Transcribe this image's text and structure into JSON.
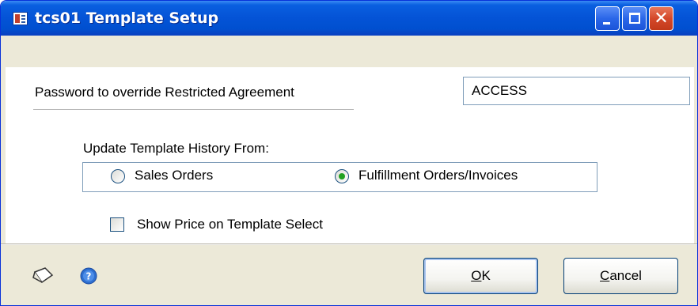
{
  "window": {
    "title": "tcs01 Template Setup"
  },
  "form": {
    "password_label": "Password to override Restricted Agreement",
    "password_value": "ACCESS",
    "history_label": "Update Template History From:",
    "history_options": [
      {
        "label": "Sales Orders",
        "selected": false
      },
      {
        "label": "Fulfillment Orders/Invoices",
        "selected": true
      }
    ],
    "show_price_label": "Show Price on Template Select",
    "show_price_checked": false
  },
  "buttons": {
    "ok_accel": "O",
    "ok_rest": "K",
    "cancel_accel": "C",
    "cancel_rest": "ancel"
  },
  "icons": {
    "app": "template-window-icon",
    "note": "note-icon",
    "help": "help-icon",
    "minimize": "minimize-icon",
    "maximize": "maximize-icon",
    "close": "close-icon"
  },
  "colors": {
    "titlebar": "#0453d6",
    "close_button": "#d4482a",
    "radio_selected": "#21a121",
    "window_face": "#ece9d8"
  }
}
